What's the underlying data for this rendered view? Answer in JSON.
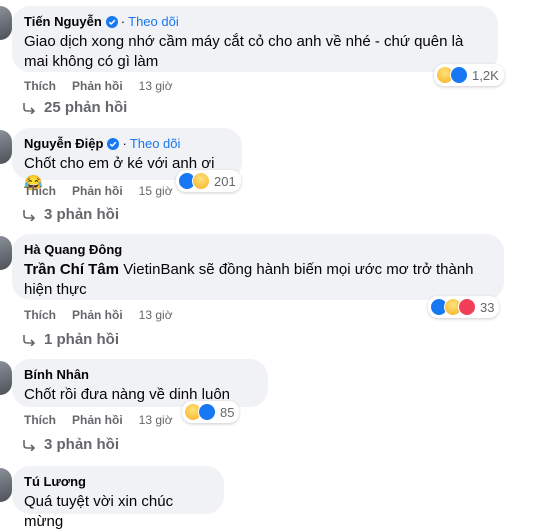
{
  "colors": {
    "link": "#1877f2",
    "muted": "#65676b",
    "bubble": "#f0f2f5"
  },
  "comments": [
    {
      "author": "Tiến Nguyễn",
      "verified": true,
      "follow": "Theo dõi",
      "text": "Giao dịch xong nhớ cầm máy cắt cỏ cho anh về nhé - chứ quên là mai không có gì làm",
      "like": "Thích",
      "reply": "Phản hồi",
      "time": "13 giờ",
      "reactions": [
        "haha-icon",
        "like-icon"
      ],
      "reaction_count": "1,2K",
      "replies": "25 phản hồi"
    },
    {
      "author": "Nguyễn Điệp",
      "verified": true,
      "follow": "Theo dõi",
      "text": "Chốt cho em ở ké với anh ơi 😂",
      "like": "Thích",
      "reply": "Phản hồi",
      "time": "15 giờ",
      "reactions": [
        "like-icon",
        "haha-icon"
      ],
      "reaction_count": "201",
      "replies": "3 phản hồi"
    },
    {
      "author": "Hà Quang Đông",
      "tag": "Trần Chí Tâm",
      "text": " VietinBank sẽ đồng hành biến mọi ước mơ trở thành hiện thực",
      "like": "Thích",
      "reply": "Phản hồi",
      "time": "13 giờ",
      "reactions": [
        "like-icon",
        "haha-icon",
        "love-icon"
      ],
      "reaction_count": "33",
      "replies": "1 phản hồi"
    },
    {
      "author": "Bính Nhân",
      "text": "Chốt rồi đưa nàng về dinh luôn",
      "like": "Thích",
      "reply": "Phản hồi",
      "time": "13 giờ",
      "reactions": [
        "haha-icon",
        "like-icon"
      ],
      "reaction_count": "85",
      "replies": "3 phản hồi"
    },
    {
      "author": "Tú Lương",
      "text": "Quá tuyệt vời xin chúc mừng"
    }
  ]
}
